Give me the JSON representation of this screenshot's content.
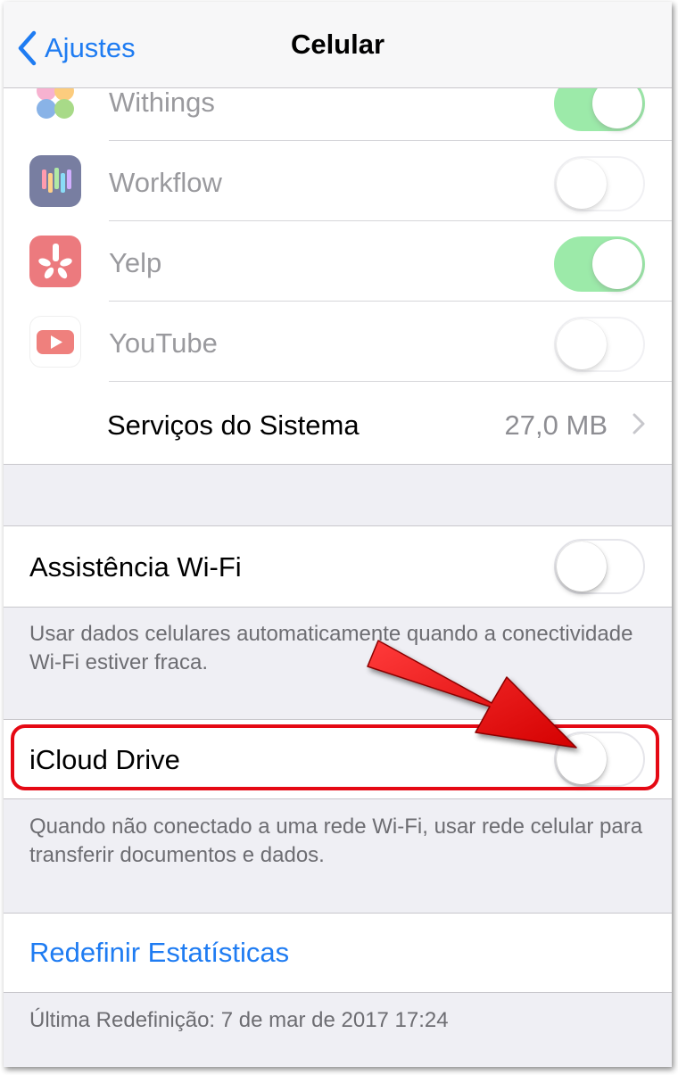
{
  "navbar": {
    "back_label": "Ajustes",
    "title": "Celular"
  },
  "apps": [
    {
      "label": "Withings",
      "icon": "withings-icon",
      "enabled": true
    },
    {
      "label": "Workflow",
      "icon": "workflow-icon",
      "enabled": false
    },
    {
      "label": "Yelp",
      "icon": "yelp-icon",
      "enabled": true
    },
    {
      "label": "YouTube",
      "icon": "youtube-icon",
      "enabled": false
    }
  ],
  "system_services": {
    "label": "Serviços do Sistema",
    "value": "27,0 MB"
  },
  "wifi_assist": {
    "label": "Assistência Wi-Fi",
    "enabled": false,
    "footer": "Usar dados celulares automaticamente quando a conectividade Wi-Fi estiver fraca."
  },
  "icloud_drive": {
    "label": "iCloud Drive",
    "enabled": false,
    "footer": "Quando não conectado a uma rede Wi-Fi, usar rede celular para transferir documentos e dados."
  },
  "reset": {
    "label": "Redefinir Estatísticas",
    "last_reset": "Última Redefinição: 7 de mar de 2017 17:24"
  },
  "colors": {
    "accent": "#1f7cf2",
    "switch_on": "#4cd964",
    "annotation_red": "#e50914"
  }
}
